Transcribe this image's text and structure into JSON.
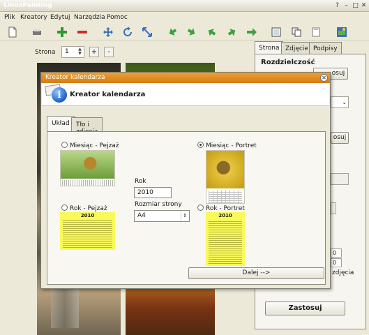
{
  "window": {
    "title": "LinuxPainting",
    "controls": [
      "?",
      "–",
      "□",
      "✕"
    ]
  },
  "menu": [
    "Plik",
    "Kreatory",
    "Edytuj",
    "Narzędzia",
    "Pomoc"
  ],
  "page_controls": {
    "label": "Strona",
    "value": "1",
    "plus": "+",
    "minus": "-"
  },
  "right_panel": {
    "tabs": [
      "Strona",
      "Zdjęcie",
      "Podpisy"
    ],
    "section_title": "Rozdzielczość",
    "apply_small": "Zastosuj",
    "apply_big": "Zastosuj",
    "partial_texts": [
      "osuj",
      "0",
      "0",
      "zdjęcia"
    ]
  },
  "dialog": {
    "title": "Kreator kalendarza",
    "heading": "Kreator kalendarza",
    "tabs": [
      "Układ",
      "Tło i zdjęcia"
    ],
    "options": {
      "month_landscape": "Miesiąc - Pejzaż",
      "month_portrait": "Miesiąc - Portret",
      "year_landscape": "Rok - Pejzaż",
      "year_portrait": "Rok - Portret"
    },
    "year_label": "Rok",
    "year_value": "2010",
    "page_size_label": "Rozmiar strony",
    "page_size_value": "A4",
    "thumb_year_text": "2010",
    "next_button": "Dalej -->"
  }
}
